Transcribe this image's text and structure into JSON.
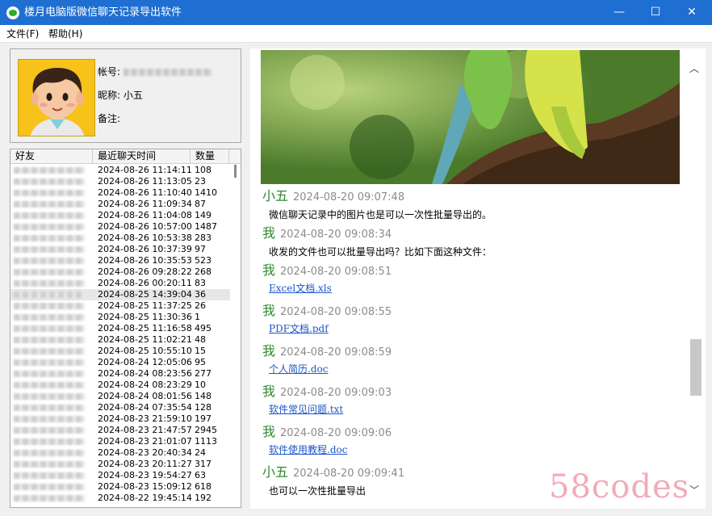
{
  "window": {
    "title": "楼月电脑版微信聊天记录导出软件",
    "minimize": "—",
    "maximize": "☐",
    "close": "✕"
  },
  "menu": {
    "file": "文件(F)",
    "help": "帮助(H)"
  },
  "profile": {
    "account_label": "帐号:",
    "nickname_label": "昵称: 小五",
    "remark_label": "备注:"
  },
  "friend_list": {
    "columns": [
      "好友",
      "最近聊天时间",
      "数量"
    ],
    "rows": [
      {
        "time": "2024-08-26 11:14:11",
        "count": "108"
      },
      {
        "time": "2024-08-26 11:13:05",
        "count": "23"
      },
      {
        "time": "2024-08-26 11:10:40",
        "count": "1410"
      },
      {
        "time": "2024-08-26 11:09:34",
        "count": "87"
      },
      {
        "time": "2024-08-26 11:04:08",
        "count": "149"
      },
      {
        "time": "2024-08-26 10:57:00",
        "count": "1487"
      },
      {
        "time": "2024-08-26 10:53:38",
        "count": "283"
      },
      {
        "time": "2024-08-26 10:37:39",
        "count": "97"
      },
      {
        "time": "2024-08-26 10:35:53",
        "count": "523"
      },
      {
        "time": "2024-08-26 09:28:22",
        "count": "268"
      },
      {
        "time": "2024-08-26 00:20:11",
        "count": "83"
      },
      {
        "time": "2024-08-25 14:39:04",
        "count": "36"
      },
      {
        "time": "2024-08-25 11:37:25",
        "count": "26"
      },
      {
        "time": "2024-08-25 11:30:36",
        "count": "1"
      },
      {
        "time": "2024-08-25 11:16:58",
        "count": "495"
      },
      {
        "time": "2024-08-25 11:02:21",
        "count": "48"
      },
      {
        "time": "2024-08-25 10:55:10",
        "count": "15"
      },
      {
        "time": "2024-08-24 12:05:06",
        "count": "95"
      },
      {
        "time": "2024-08-24 08:23:56",
        "count": "277"
      },
      {
        "time": "2024-08-24 08:23:29",
        "count": "10"
      },
      {
        "time": "2024-08-24 08:01:56",
        "count": "148"
      },
      {
        "time": "2024-08-24 07:35:54",
        "count": "128"
      },
      {
        "time": "2024-08-23 21:59:10",
        "count": "197"
      },
      {
        "time": "2024-08-23 21:47:57",
        "count": "2945"
      },
      {
        "time": "2024-08-23 21:01:07",
        "count": "1113"
      },
      {
        "time": "2024-08-23 20:40:34",
        "count": "24"
      },
      {
        "time": "2024-08-23 20:11:27",
        "count": "317"
      },
      {
        "time": "2024-08-23 19:54:27",
        "count": "63"
      },
      {
        "time": "2024-08-23 15:09:12",
        "count": "618"
      },
      {
        "time": "2024-08-22 19:45:14",
        "count": "192"
      }
    ],
    "selected_row": 11
  },
  "messages": [
    {
      "sender": "小五",
      "time": "2024-08-20 09:07:48",
      "text": "微信聊天记录中的图片也是可以一次性批量导出的。"
    },
    {
      "sender": "我",
      "time": "2024-08-20 09:08:34",
      "text": "收发的文件也可以批量导出吗？比如下面这种文件："
    },
    {
      "sender": "我",
      "time": "2024-08-20 09:08:51",
      "link": "Excel文档.xls"
    },
    {
      "sender": "我",
      "time": "2024-08-20 09:08:55",
      "link": "PDF文档.pdf"
    },
    {
      "sender": "我",
      "time": "2024-08-20 09:08:59",
      "link": "个人简历.doc"
    },
    {
      "sender": "我",
      "time": "2024-08-20 09:09:03",
      "link": "软件常见问题.txt"
    },
    {
      "sender": "我",
      "time": "2024-08-20 09:09:06",
      "link": "软件使用教程.doc"
    },
    {
      "sender": "小五",
      "time": "2024-08-20 09:09:41",
      "text": "也可以一次性批量导出"
    }
  ],
  "scrollbar": {
    "up": "︿",
    "down": "﹀"
  },
  "watermark": "58codes",
  "colors": {
    "titlebar": "#1f6fd2",
    "sender": "#2d8a2d",
    "link": "#1a56c8",
    "watermark": "#f2a7b4"
  }
}
